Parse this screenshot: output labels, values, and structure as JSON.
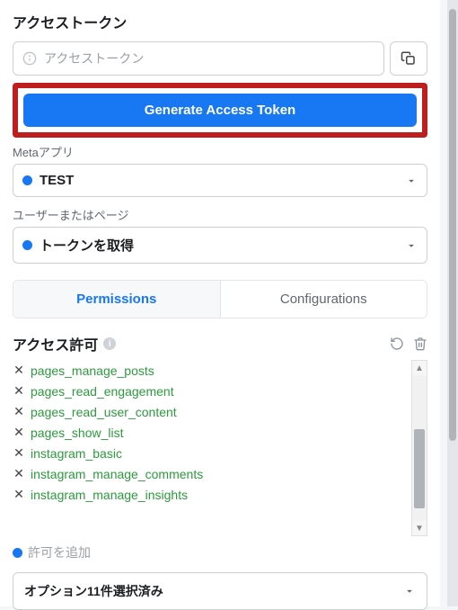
{
  "section_title": "アクセストークン",
  "token_input": {
    "placeholder": "アクセストークン",
    "value": ""
  },
  "generate_button_label": "Generate Access Token",
  "meta_app": {
    "label": "Metaアプリ",
    "value": "TEST"
  },
  "user_page": {
    "label": "ユーザーまたはページ",
    "value": "トークンを取得"
  },
  "tabs": {
    "permissions": "Permissions",
    "configurations": "Configurations"
  },
  "permissions_section": {
    "title": "アクセス許可"
  },
  "permissions": [
    "pages_manage_posts",
    "pages_read_engagement",
    "pages_read_user_content",
    "pages_show_list",
    "instagram_basic",
    "instagram_manage_comments",
    "instagram_manage_insights"
  ],
  "add_permission_placeholder": "許可を追加",
  "options_selected_label": "オプション11件選択済み"
}
